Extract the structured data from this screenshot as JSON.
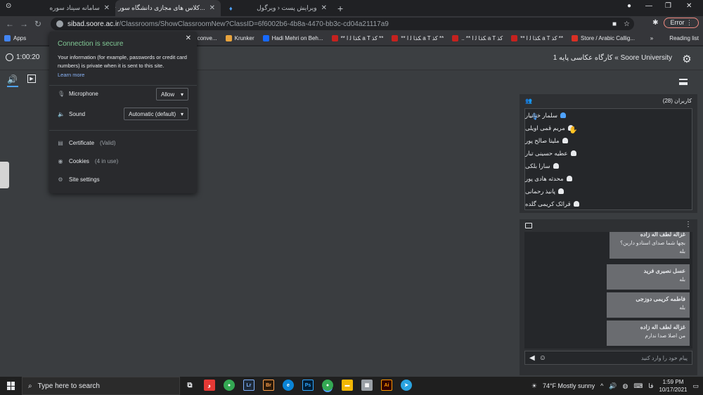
{
  "tabs": [
    {
      "label": "سامانه سیناد سوره",
      "active": false
    },
    {
      "label": "✦ کلاس های مجازی دانشگاه سور...",
      "active": true
    },
    {
      "label": "ویرایش پست ‹ ویرگول",
      "active": false
    }
  ],
  "address": {
    "host": "sibad.soore.ac.ir",
    "path": "/Classrooms/ShowClassroomNew?ClassID=6f6002b6-4b8a-4470-bb3c-cd04a21117a9"
  },
  "error_label": "Error",
  "bookmarks": {
    "apps": "Apps",
    "items": [
      "video conve...",
      "Krunker",
      "Hadi Mehri on Beh...",
      "** ﻜﺬﺎ ﻟ ﺍ a T ﮐﺬ **",
      "** ﻜﺬﺎ ﻟ ﺍ a T ﮐﺬ **",
      ".. ** ﻜﺬﺎ ﻟ ﺍ a T ﮐﺬ",
      "** ﻜﺬﺎ ﻟ ﺍ a T ﮐﺬ **",
      "Store / Arabic Callig..."
    ],
    "reading_list": "Reading list"
  },
  "popup": {
    "secure": "Connection is secure",
    "info": "Your information (for example, passwords or credit card numbers) is private when it is sent to this site.",
    "learn": "Learn more",
    "microphone": "Microphone",
    "microphone_value": "Allow",
    "sound": "Sound",
    "sound_value": "Automatic (default)",
    "certificate": "Certificate",
    "certificate_sub": "(Valid)",
    "cookies": "Cookies",
    "cookies_sub": "(4 in use)",
    "site_settings": "Site settings"
  },
  "classroom": {
    "timer": "1:00:20",
    "title": "Soore University » کارگاه عکاسی پایه 1",
    "users_title": "کاربران (28)",
    "users": [
      "سلمار خنانیار",
      "مریم قمی اویلی",
      "ملیتا صالح پور",
      "عطیه حسینی تبار",
      "سارا بلکی",
      "محدثه هادی پور",
      "پانیذ رحمانی",
      "قرائک کریمی گلده"
    ],
    "messages": [
      {
        "name": "غزاله لطف اله زاده",
        "text": "بچها شما صدای استادو دارین؟"
      },
      {
        "name": "",
        "text": "بله"
      },
      {
        "name": "عسل نصیری فرید",
        "text": "بله"
      },
      {
        "name": "فاطمه کریمی دوزجی",
        "text": "بله"
      },
      {
        "name": "غزاله لطف اله زاده",
        "text": "من اصلا صدا ندارم"
      }
    ],
    "chat_placeholder": "پیام خود را وارد کنید"
  },
  "taskbar": {
    "search": "Type here to search",
    "weather": "74°F  Mostly sunny",
    "lang": "فا",
    "time": "1:59 PM",
    "date": "10/17/2021"
  }
}
